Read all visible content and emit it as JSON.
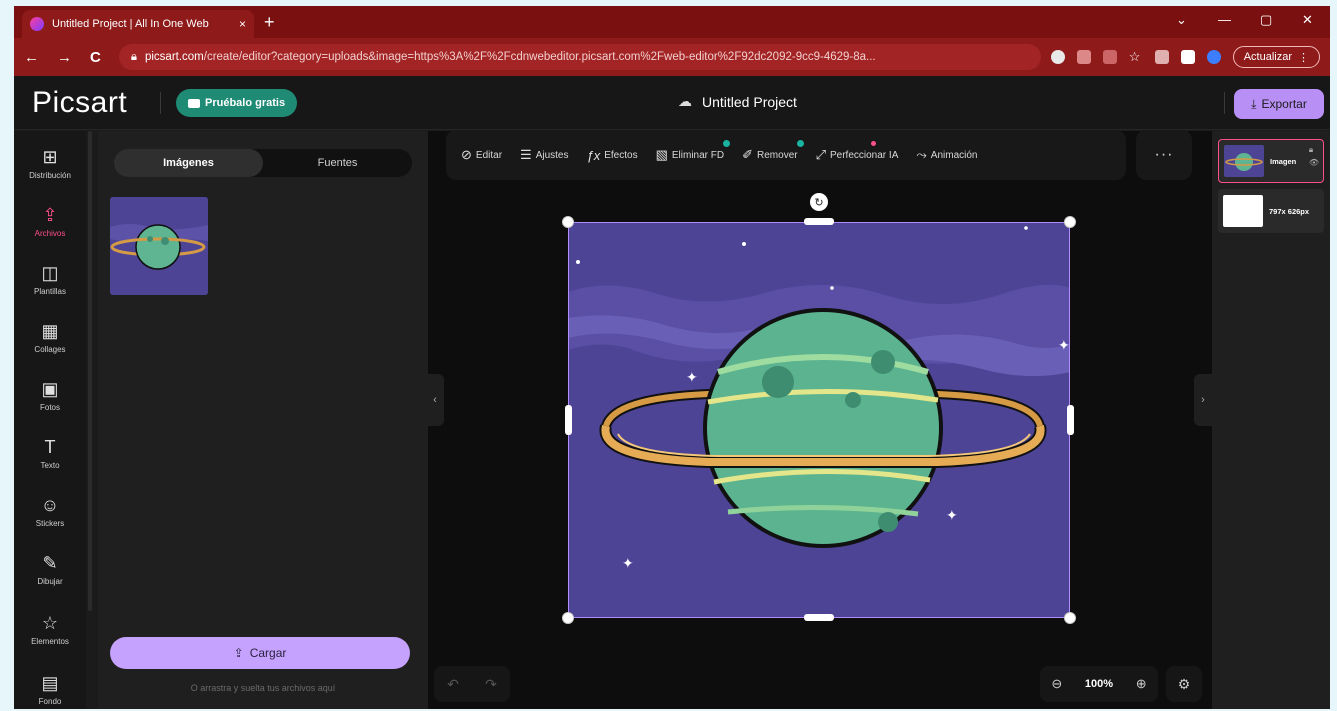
{
  "browser": {
    "tab_title": "Untitled Project | All In One Web",
    "tab_close": "×",
    "new_tab": "+",
    "win_minimize": "—",
    "win_maximize": "▢",
    "win_close": "✕",
    "win_tabsearch": "⌄",
    "url_host": "picsart.com",
    "url_path": "/create/editor?category=uploads&image=https%3A%2F%2Fcdnwebeditor.picsart.com%2Fweb-editor%2F92dc2092-9cc9-4629-8a...",
    "update_label": "Actualizar",
    "nav_back": "←",
    "nav_forward": "→",
    "nav_reload": "C"
  },
  "header": {
    "logo": "Picsart",
    "trial_label": "Pruébalo gratis",
    "project_title": "Untitled Project",
    "export_label": "Exportar"
  },
  "rail": {
    "items": [
      {
        "label": "Distribución",
        "icon": "⊞"
      },
      {
        "label": "Archivos",
        "icon": "⇪"
      },
      {
        "label": "Plantillas",
        "icon": "◫"
      },
      {
        "label": "Collages",
        "icon": "▦"
      },
      {
        "label": "Fotos",
        "icon": "▣"
      },
      {
        "label": "Texto",
        "icon": "T"
      },
      {
        "label": "Stickers",
        "icon": "☺"
      },
      {
        "label": "Dibujar",
        "icon": "✎"
      },
      {
        "label": "Elementos",
        "icon": "☆"
      },
      {
        "label": "Fondo",
        "icon": "▤"
      }
    ]
  },
  "panel": {
    "tab_images": "Imágenes",
    "tab_sources": "Fuentes",
    "upload_label": "Cargar",
    "upload_hint": "O arrastra y suelta tus archivos aquí"
  },
  "toolbar": {
    "tools": [
      {
        "label": "Editar",
        "icon": "⊘"
      },
      {
        "label": "Ajustes",
        "icon": "☰"
      },
      {
        "label": "Efectos",
        "icon": "ƒx"
      },
      {
        "label": "Eliminar FD",
        "icon": "▧"
      },
      {
        "label": "Remover",
        "icon": "✐"
      },
      {
        "label": "Perfeccionar IA",
        "icon": "⤢"
      },
      {
        "label": "Animación",
        "icon": "⤳"
      }
    ],
    "more": "···"
  },
  "canvas": {
    "zoom": "100%",
    "undo": "↶",
    "redo": "↷",
    "zoom_out": "⊖",
    "zoom_in": "⊕",
    "settings": "⚙",
    "rotate": "↻",
    "collapse_left": "‹",
    "collapse_right": "›"
  },
  "layers": {
    "items": [
      {
        "name": "Imagen"
      },
      {
        "name": "797x 626px"
      }
    ]
  },
  "colors": {
    "accent_purple": "#b890f5",
    "trial_green": "#1f8b75",
    "active_pink": "#ff4f8a",
    "browser_red": "#8e1a1a",
    "space_bg": "#4e4496"
  }
}
